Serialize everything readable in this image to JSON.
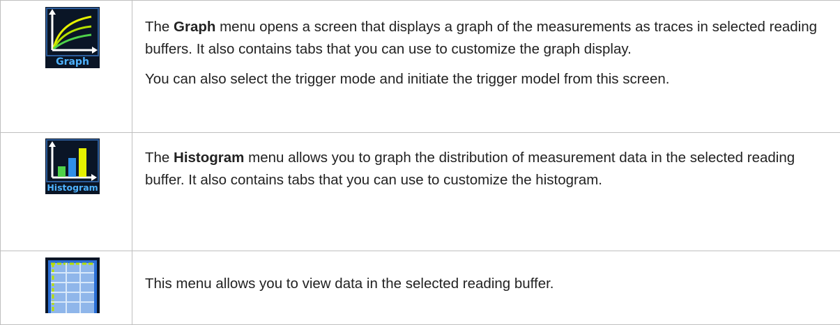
{
  "rows": [
    {
      "icon": {
        "name": "graph-icon",
        "label": "Graph"
      },
      "paragraphs": [
        {
          "before": "The ",
          "bold": "Graph",
          "after": " menu opens a screen that displays a graph of the measurements as traces in selected reading buffers. It also contains tabs that you can use to customize the graph display."
        },
        {
          "before": "",
          "bold": "",
          "after": "You can also select the trigger mode and initiate the trigger model from this screen."
        }
      ]
    },
    {
      "icon": {
        "name": "histogram-icon",
        "label": "Histogram"
      },
      "paragraphs": [
        {
          "before": "The ",
          "bold": "Histogram",
          "after": " menu allows you to graph the distribution of measurement data in the selected reading buffer. It also contains tabs that you can use to customize the histogram."
        }
      ]
    },
    {
      "icon": {
        "name": "reading-table-icon",
        "label": ""
      },
      "paragraphs": [
        {
          "before": "",
          "bold": "",
          "after": "This menu allows you to view data in the selected reading buffer."
        }
      ]
    }
  ]
}
